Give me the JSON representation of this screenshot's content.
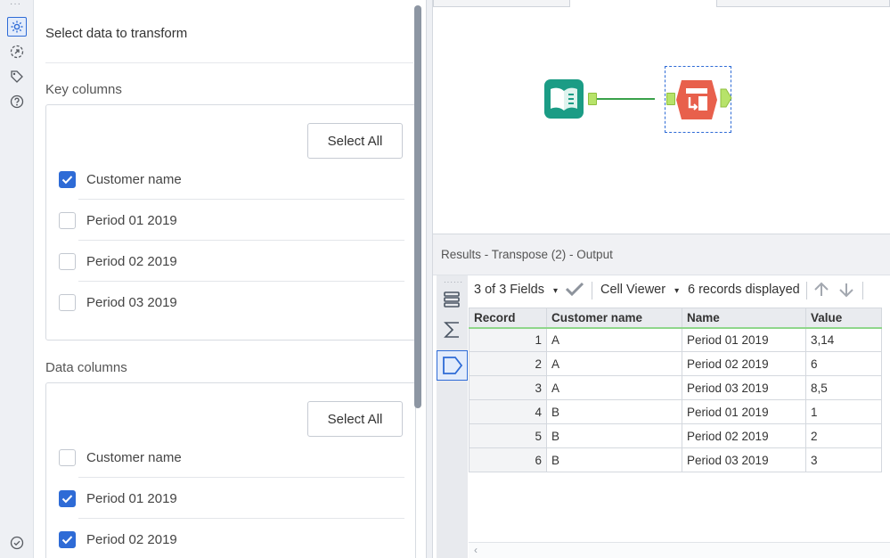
{
  "config": {
    "title": "Select data to transform",
    "key_columns": {
      "label": "Key columns",
      "select_all": "Select All",
      "items": [
        {
          "label": "Customer name",
          "checked": true
        },
        {
          "label": "Period 01 2019",
          "checked": false
        },
        {
          "label": "Period 02 2019",
          "checked": false
        },
        {
          "label": "Period 03 2019",
          "checked": false
        }
      ]
    },
    "data_columns": {
      "label": "Data columns",
      "select_all": "Select All",
      "items": [
        {
          "label": "Customer name",
          "checked": false
        },
        {
          "label": "Period 01 2019",
          "checked": true
        },
        {
          "label": "Period 02 2019",
          "checked": true
        }
      ]
    }
  },
  "rail_icons": [
    "gear-icon",
    "arrow-out-icon",
    "tag-icon",
    "help-icon",
    "check-circle-icon"
  ],
  "canvas": {
    "tools": [
      {
        "name": "input-data-tool-icon",
        "color": "#1b9c85"
      },
      {
        "name": "transpose-tool-icon",
        "color": "#e8604c"
      }
    ],
    "connection_color": "#3aa14a"
  },
  "results": {
    "title": "Results - Transpose (2) - Output",
    "fields": "3 of 3 Fields",
    "cell_viewer": "Cell Viewer",
    "records": "6 records displayed",
    "columns": [
      "Record",
      "Customer name",
      "Name",
      "Value"
    ],
    "rows": [
      [
        "1",
        "A",
        "Period 01 2019",
        "3,14"
      ],
      [
        "2",
        "A",
        "Period 02 2019",
        "6"
      ],
      [
        "3",
        "A",
        "Period 03 2019",
        "8,5"
      ],
      [
        "4",
        "B",
        "Period 01 2019",
        "1"
      ],
      [
        "5",
        "B",
        "Period 02 2019",
        "2"
      ],
      [
        "6",
        "B",
        "Period 03 2019",
        "3"
      ]
    ]
  },
  "colors": {
    "accent": "#2e6bd6",
    "header_underline": "#8fd68b"
  }
}
